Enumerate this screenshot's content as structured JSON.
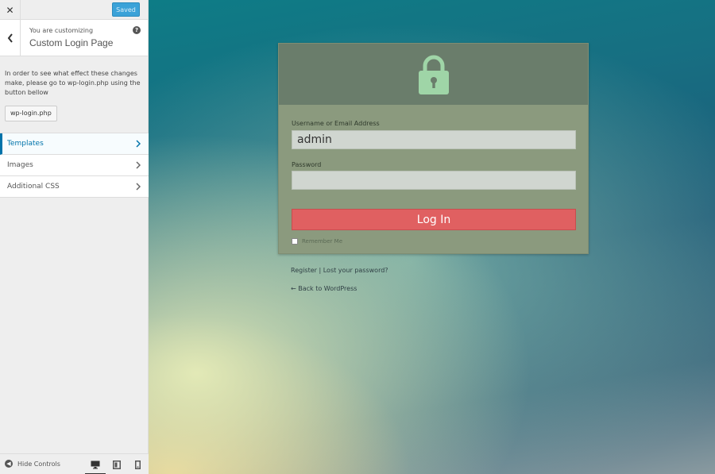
{
  "topbar": {
    "close_label": "✕",
    "saved_label": "Saved"
  },
  "header": {
    "you_are": "You are customizing",
    "title": "Custom Login Page",
    "help": "?"
  },
  "notice": {
    "text": "In order to see what effect these changes make, please go to wp-login.php using the button bellow",
    "button_label": "wp-login.php"
  },
  "menu": {
    "items": [
      {
        "label": "Templates"
      },
      {
        "label": "Images"
      },
      {
        "label": "Additional CSS"
      }
    ]
  },
  "footer": {
    "hide_controls": "Hide Controls"
  },
  "login": {
    "username_label": "Username or Email Address",
    "username_value": "admin",
    "password_label": "Password",
    "password_value": "",
    "button_label": "Log In",
    "remember_label": "Remember Me",
    "register_link": "Register",
    "separator": "|",
    "lost_password_link": "Lost your password?",
    "back_link": "← Back to WordPress"
  },
  "colors": {
    "accent": "#0073aa",
    "saved_button": "#3ba2d8",
    "login_button": "#e06061",
    "lock_icon": "#9fd5a7"
  }
}
